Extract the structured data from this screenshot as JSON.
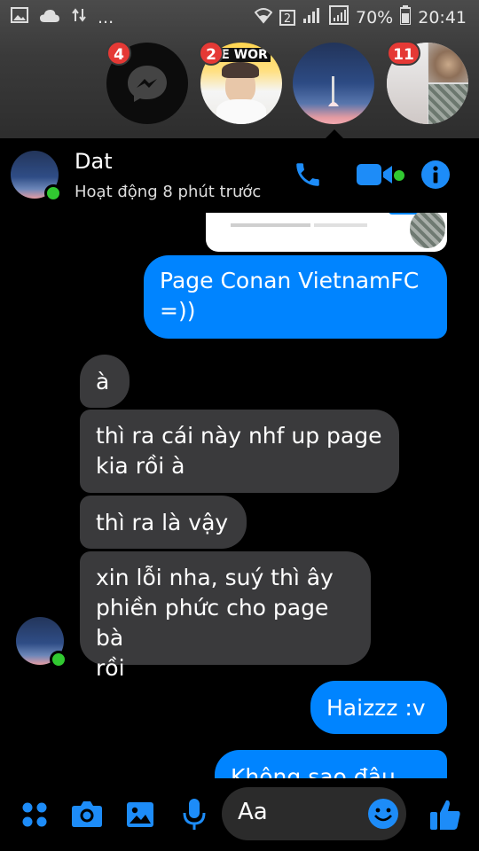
{
  "status_bar": {
    "battery": "70%",
    "time": "20:41",
    "sim_slot": "2",
    "dots": "..."
  },
  "chat_heads": [
    {
      "name": "messenger-head",
      "badge": "4"
    },
    {
      "name": "contact-head-2",
      "badge": "2",
      "art_text": "PE WOR"
    },
    {
      "name": "contact-head-dat-active",
      "badge": ""
    },
    {
      "name": "group-head",
      "badge": "11"
    }
  ],
  "header": {
    "name": "Dat",
    "status": "Hoạt động 8 phút trước"
  },
  "messages": [
    {
      "dir": "out",
      "text": "Page Conan VietnamFC\n=))"
    },
    {
      "dir": "in",
      "text": "à"
    },
    {
      "dir": "in",
      "text": "thì ra cái này nhf up page\nkia rồi à"
    },
    {
      "dir": "in",
      "text": "thì ra là vậy"
    },
    {
      "dir": "in",
      "text": "xin lỗi nha, suý thì ây\nphiền phức cho page bà\nrồi"
    },
    {
      "dir": "out",
      "text": "Haizzz :v"
    },
    {
      "dir": "out",
      "text": "Không sao đâu mà"
    }
  ],
  "composer": {
    "placeholder": "Aa"
  },
  "colors": {
    "accent": "#0084ff",
    "incoming": "#3a3a3c",
    "online": "#31c931",
    "badge": "#e53935"
  }
}
